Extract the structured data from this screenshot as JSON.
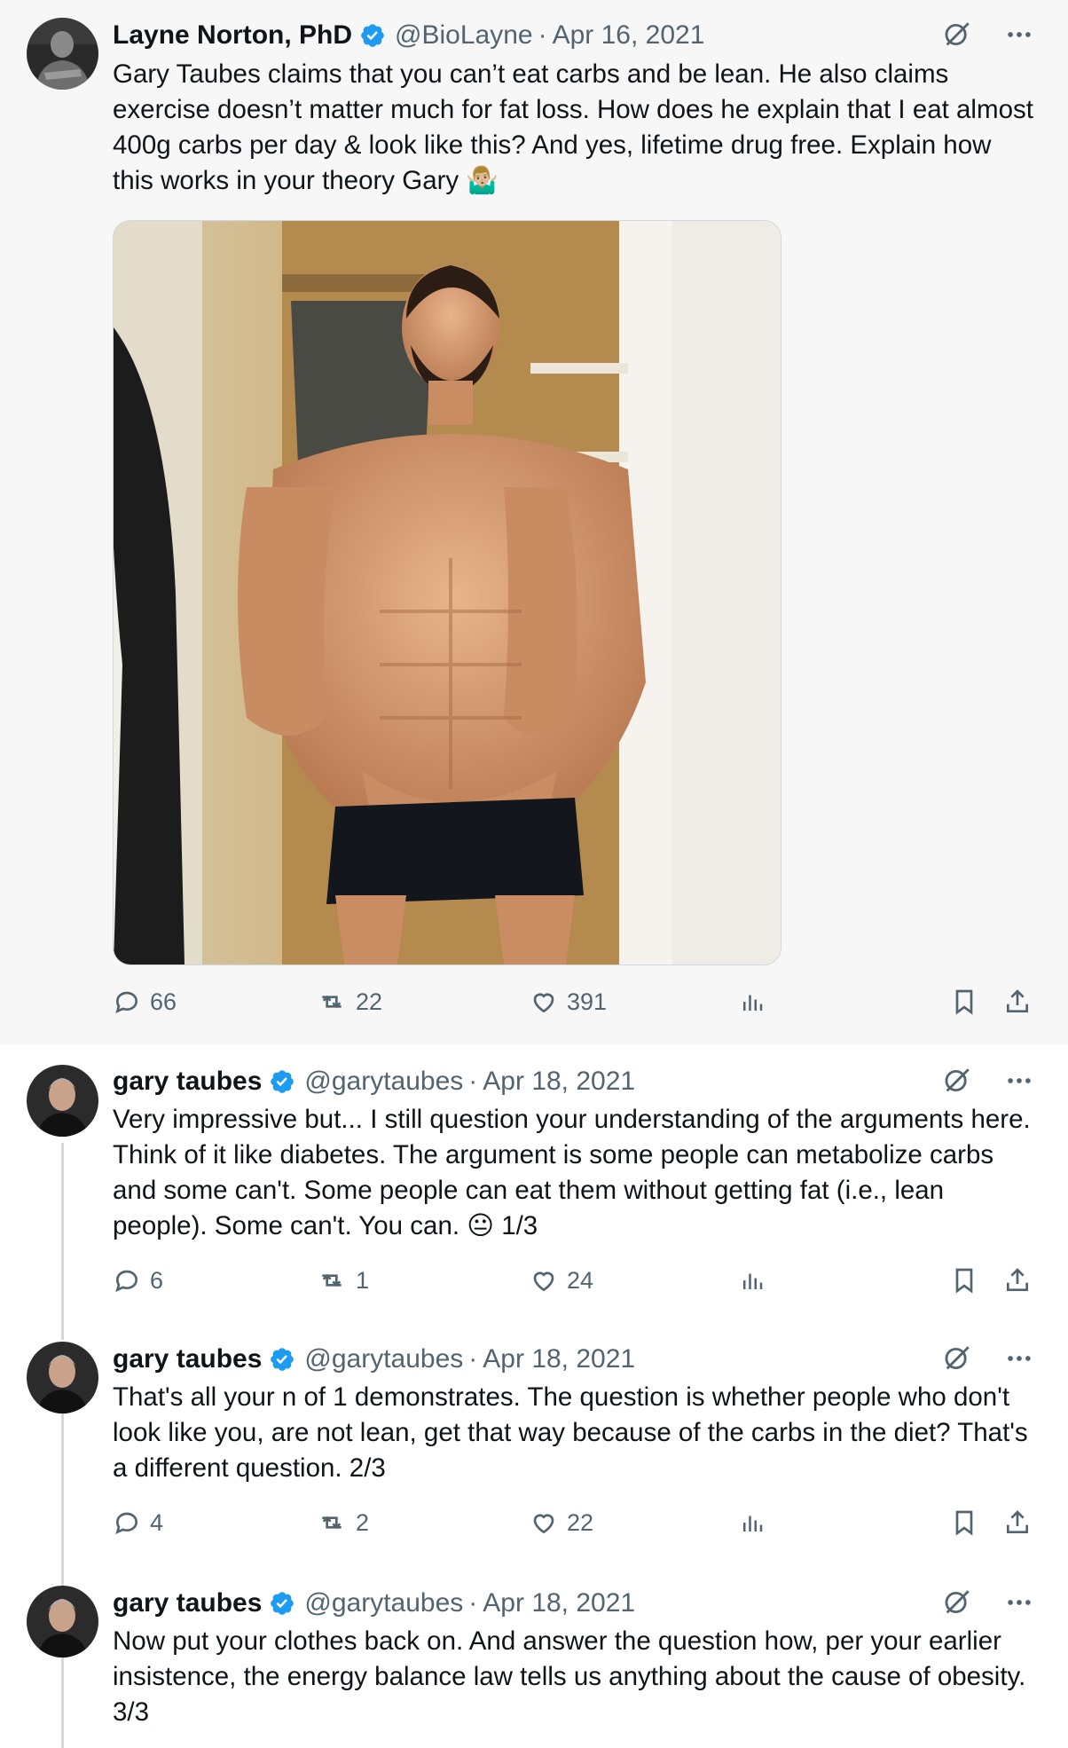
{
  "tweets": [
    {
      "author": "Layne Norton, PhD",
      "handle": "@BioLayne",
      "separator": "·",
      "date": "Apr 16, 2021",
      "text": "Gary Taubes claims that you can’t eat carbs and be lean. He also claims exercise doesn’t matter much for fat loss. How does he explain that I eat almost 400g carbs per day & look like this? And yes, lifetime drug free. Explain how this works in your theory Gary 🤷🏼‍♂️",
      "replies": "66",
      "reposts": "22",
      "likes": "391"
    },
    {
      "author": "gary taubes",
      "handle": "@garytaubes",
      "separator": "·",
      "date": "Apr 18, 2021",
      "text": "Very impressive but... I still question your understanding of the arguments here. Think of it like diabetes. The argument is some people can metabolize carbs and some can't. Some people can eat them without getting fat (i.e., lean people).  Some can't.  You can. 😐 1/3",
      "replies": "6",
      "reposts": "1",
      "likes": "24"
    },
    {
      "author": "gary taubes",
      "handle": "@garytaubes",
      "separator": "·",
      "date": "Apr 18, 2021",
      "text": "That's all your n of 1 demonstrates. The question is whether people who don't look like you, are not lean, get that way because of the carbs in the diet? That's a different question. 2/3",
      "replies": "4",
      "reposts": "2",
      "likes": "22"
    },
    {
      "author": "gary taubes",
      "handle": "@garytaubes",
      "separator": "·",
      "date": "Apr 18, 2021",
      "text": "Now put your clothes back on. And answer the question how, per your earlier insistence, the energy balance law tells us anything about the cause of obesity. 3/3"
    }
  ],
  "colors": {
    "verified": "#1d9bf0",
    "text": "#0f1419",
    "secondary": "#536471",
    "thread_line": "#cfd9de",
    "highlight_bg": "#f7f7f7"
  },
  "icons": [
    "verified-badge-icon",
    "grok-icon",
    "more-icon",
    "reply-icon",
    "repost-icon",
    "like-icon",
    "views-icon",
    "bookmark-icon",
    "share-icon"
  ]
}
